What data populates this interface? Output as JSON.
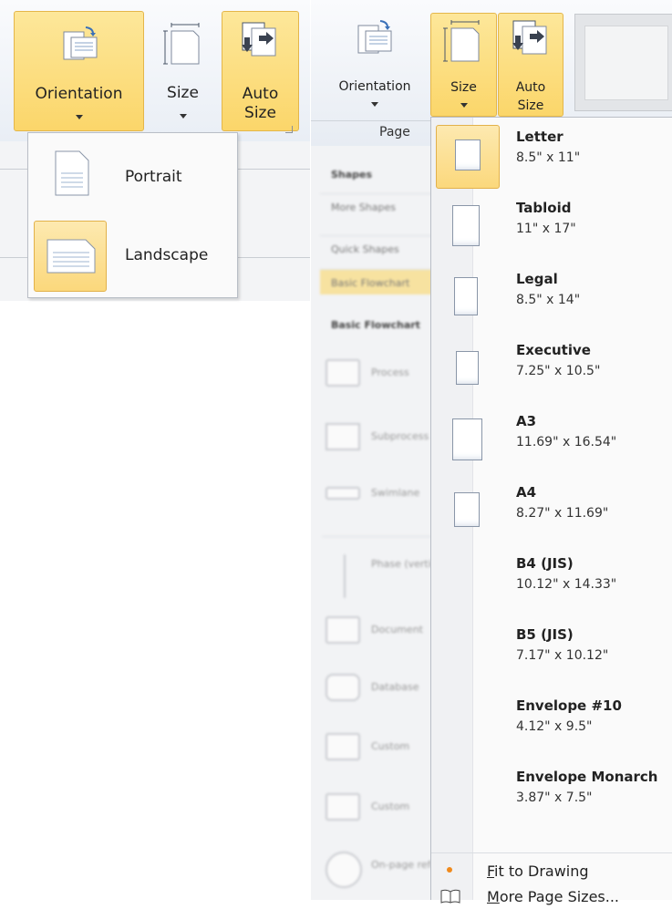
{
  "left_panel": {
    "ribbon": {
      "orientation_label": "Orientation",
      "size_label": "Size",
      "auto_size_label_1": "Auto",
      "auto_size_label_2": "Size"
    },
    "orientation_menu": {
      "items": [
        {
          "label": "Portrait",
          "selected": false
        },
        {
          "label": "Landscape",
          "selected": true
        }
      ]
    }
  },
  "right_panel": {
    "ribbon": {
      "orientation_label": "Orientation",
      "size_label": "Size",
      "auto_size_label_1": "Auto",
      "auto_size_label_2": "Size",
      "group_label": "Page"
    },
    "shapes_pane": {
      "title": "Shapes",
      "rows": [
        "More Shapes",
        "Quick Shapes",
        "Basic Flowchart"
      ],
      "section": "Basic Flowchart",
      "stencils": [
        "Process",
        "Subprocess",
        "Swimlane",
        "Phase (vertical)",
        "Document",
        "Database",
        "Custom",
        "Custom",
        "On-page reference"
      ]
    },
    "size_menu": {
      "items": [
        {
          "name": "Letter",
          "dims": "8.5\" x 11\"",
          "selected": true
        },
        {
          "name": "Tabloid",
          "dims": "11\" x 17\"",
          "selected": false
        },
        {
          "name": "Legal",
          "dims": "8.5\" x 14\"",
          "selected": false
        },
        {
          "name": "Executive",
          "dims": "7.25\" x 10.5\"",
          "selected": false
        },
        {
          "name": "A3",
          "dims": "11.69\" x 16.54\"",
          "selected": false
        },
        {
          "name": "A4",
          "dims": "8.27\" x 11.69\"",
          "selected": false
        },
        {
          "name": "B4 (JIS)",
          "dims": "10.12\" x 14.33\"",
          "selected": false
        },
        {
          "name": "B5 (JIS)",
          "dims": "7.17\" x 10.12\"",
          "selected": false
        },
        {
          "name": "Envelope #10",
          "dims": "4.12\" x 9.5\"",
          "selected": false
        },
        {
          "name": "Envelope Monarch",
          "dims": "3.87\" x 7.5\"",
          "selected": false
        }
      ],
      "commands": {
        "fit_to_drawing": "Fit to Drawing",
        "fit_to_drawing_accel": "F",
        "fit_to_drawing_rest": "it to Drawing",
        "more_page_sizes_accel": "M",
        "more_page_sizes_rest": "ore Page Sizes..."
      }
    }
  },
  "colors": {
    "highlight": "#fbd66a",
    "highlight_border": "#e4b64a",
    "menu_bg": "#fafafa"
  }
}
